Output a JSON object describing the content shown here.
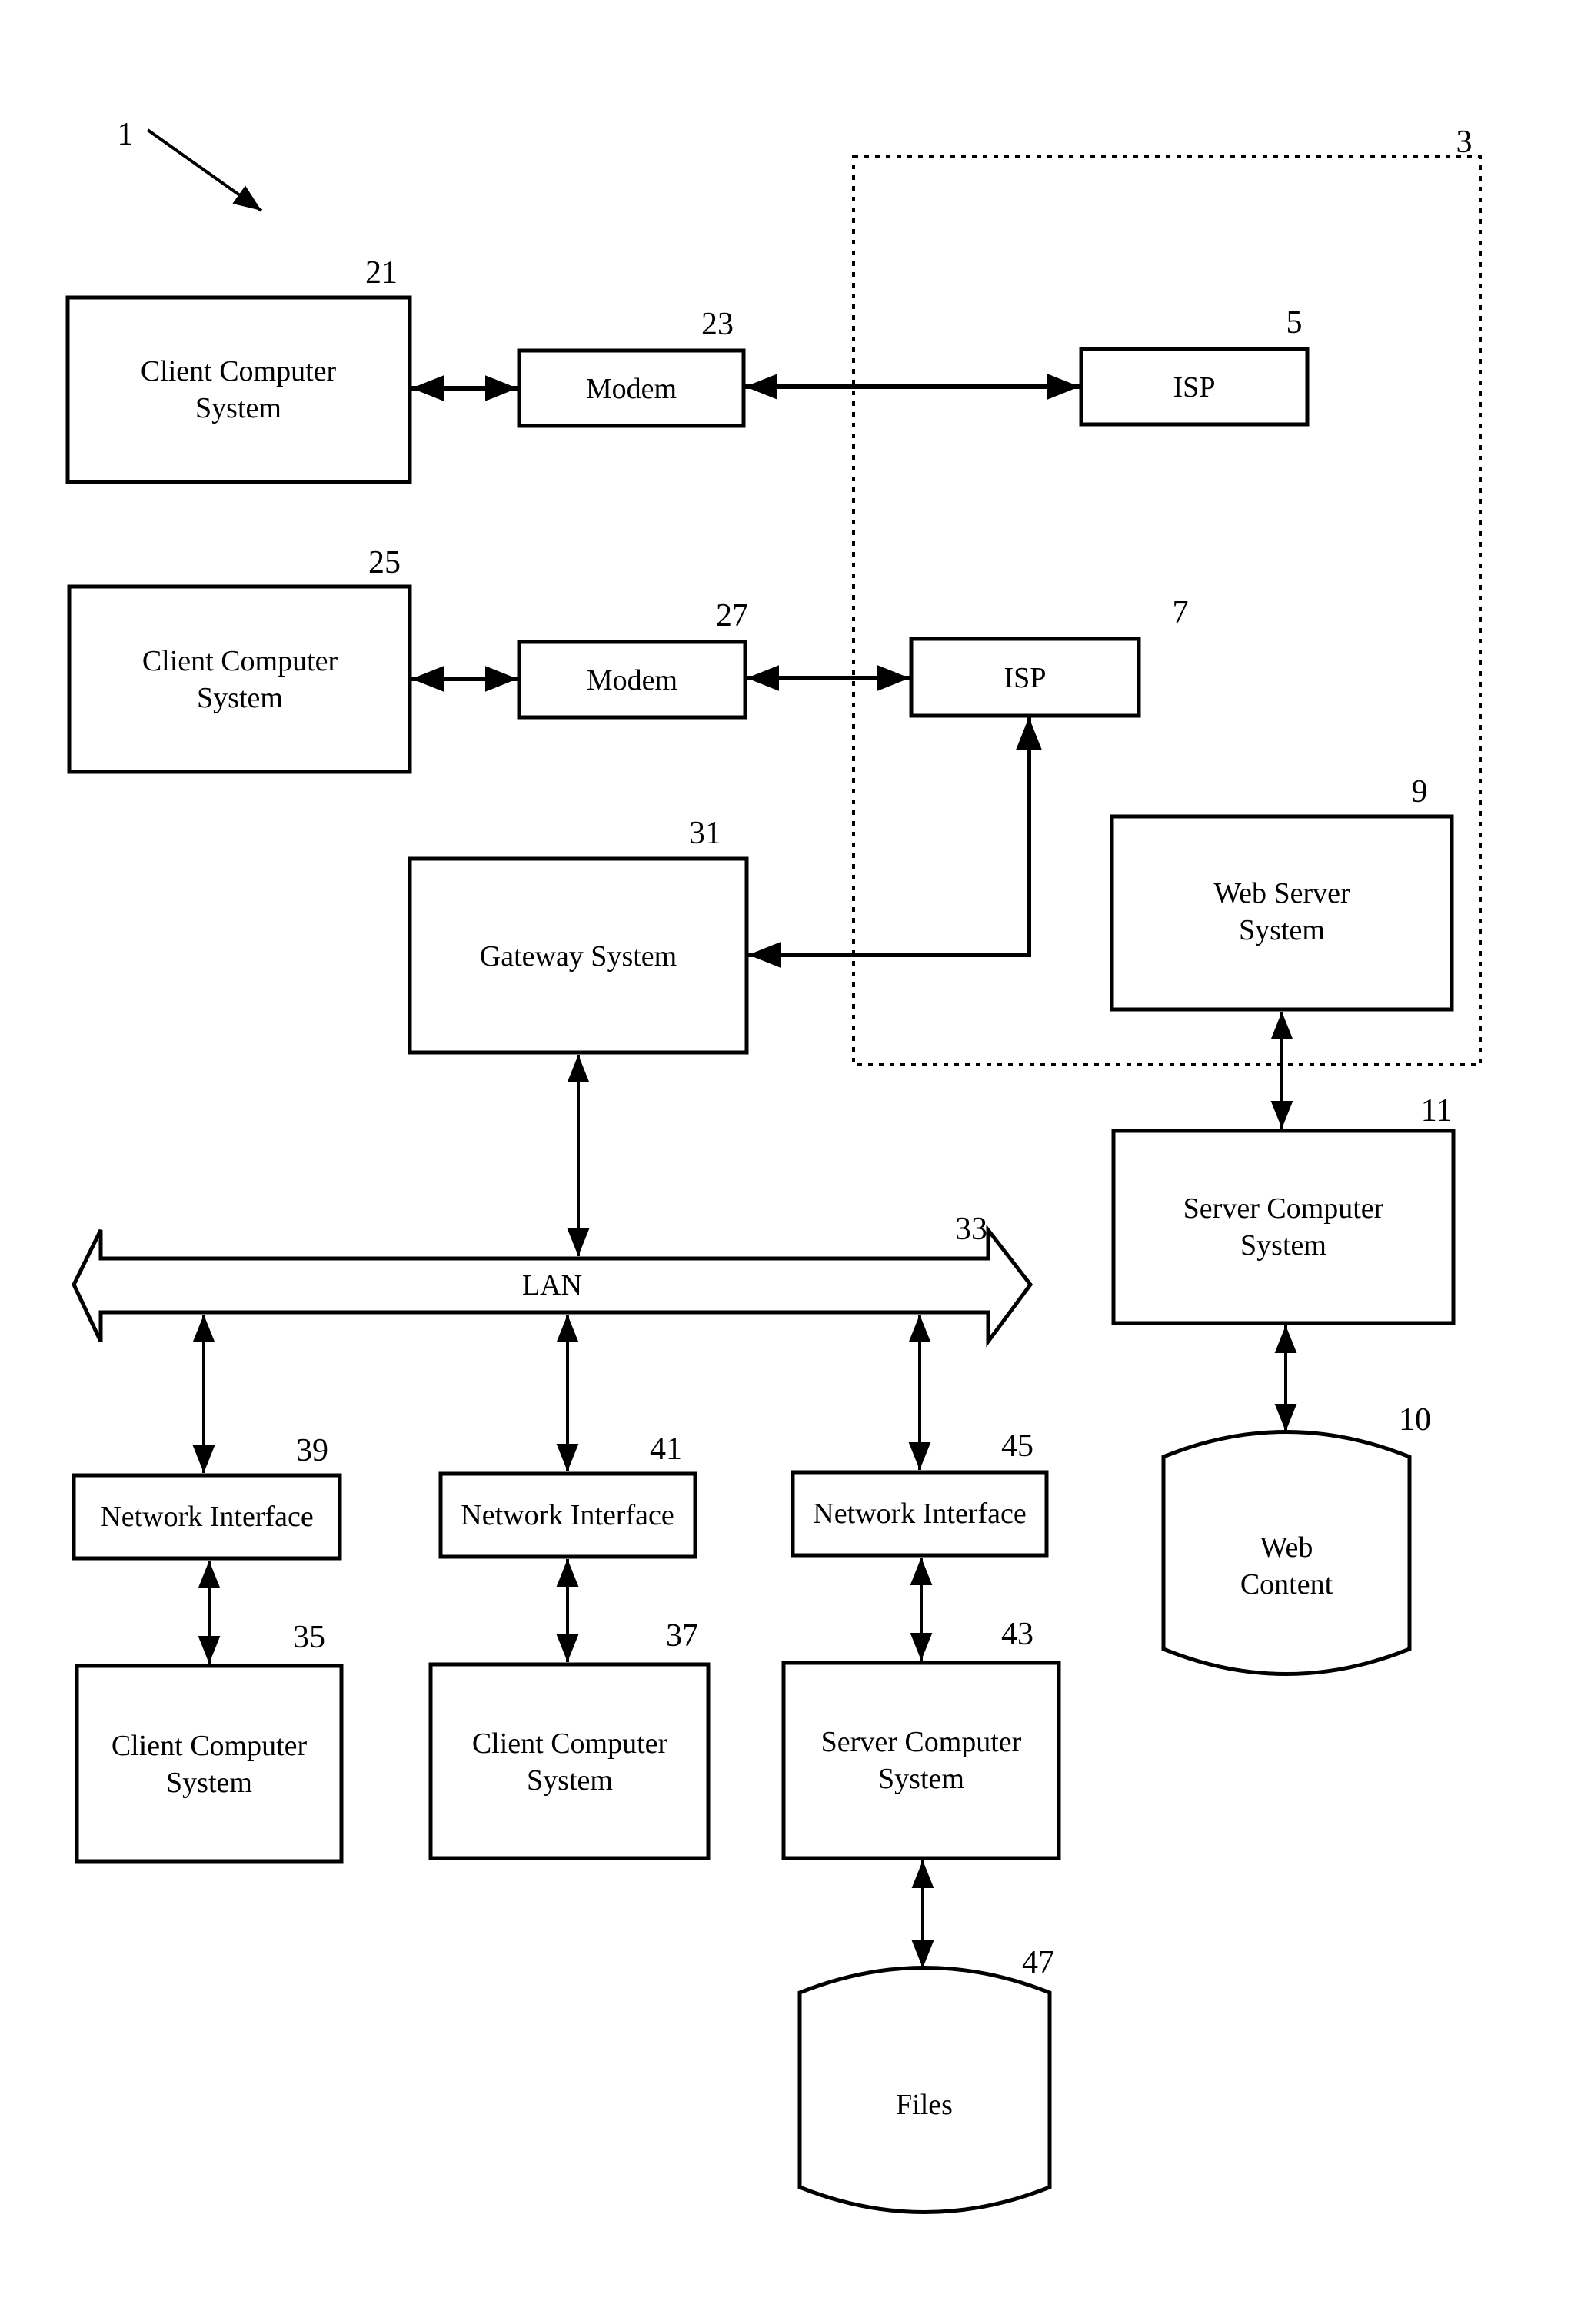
{
  "figure": {
    "reference": "1",
    "internet_group": {
      "ref": "3"
    },
    "nodes": {
      "client21": {
        "ref": "21",
        "line1": "Client Computer",
        "line2": "System"
      },
      "modem23": {
        "ref": "23",
        "label": "Modem"
      },
      "isp5": {
        "ref": "5",
        "label": "ISP"
      },
      "client25": {
        "ref": "25",
        "line1": "Client Computer",
        "line2": "System"
      },
      "modem27": {
        "ref": "27",
        "label": "Modem"
      },
      "isp7": {
        "ref": "7",
        "label": "ISP"
      },
      "gateway31": {
        "ref": "31",
        "label": "Gateway System"
      },
      "webserver9": {
        "ref": "9",
        "line1": "Web Server",
        "line2": "System"
      },
      "server11": {
        "ref": "11",
        "line1": "Server Computer",
        "line2": "System"
      },
      "webcontent10": {
        "ref": "10",
        "line1": "Web",
        "line2": "Content"
      },
      "lan33": {
        "ref": "33",
        "label": "LAN"
      },
      "ni39": {
        "ref": "39",
        "label": "Network Interface"
      },
      "ni41": {
        "ref": "41",
        "label": "Network Interface"
      },
      "ni45": {
        "ref": "45",
        "label": "Network Interface"
      },
      "client35": {
        "ref": "35",
        "line1": "Client Computer",
        "line2": "System"
      },
      "client37": {
        "ref": "37",
        "line1": "Client Computer",
        "line2": "System"
      },
      "server43": {
        "ref": "43",
        "line1": "Server Computer",
        "line2": "System"
      },
      "files47": {
        "ref": "47",
        "label": "Files"
      }
    }
  }
}
